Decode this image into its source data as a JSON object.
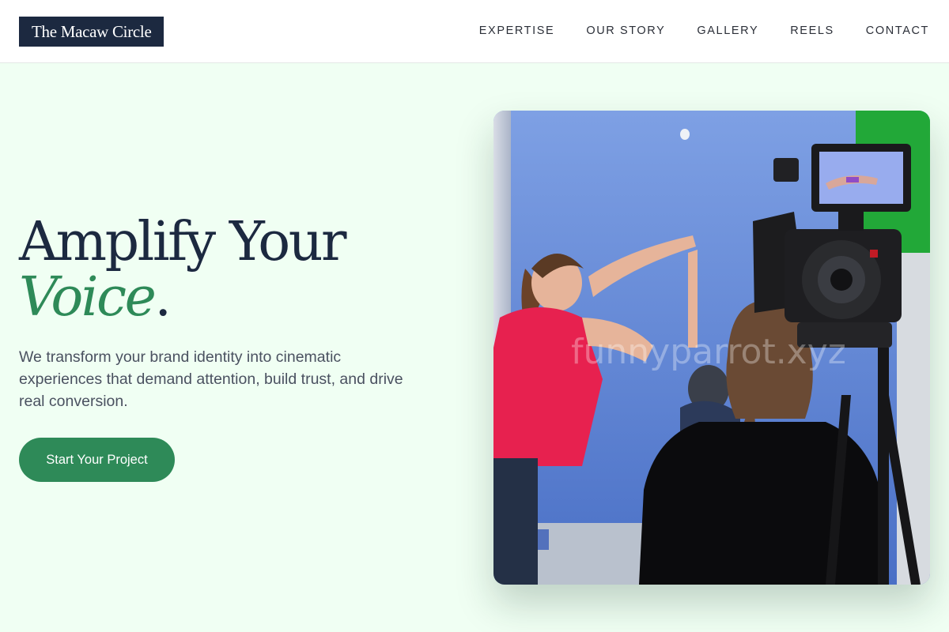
{
  "header": {
    "logo_text": "The Macaw Circle",
    "nav": [
      {
        "label": "EXPERTISE"
      },
      {
        "label": "OUR STORY"
      },
      {
        "label": "GALLERY"
      },
      {
        "label": "REELS"
      },
      {
        "label": "CONTACT"
      }
    ]
  },
  "hero": {
    "title_line1": "Amplify Your",
    "title_accent": "Voice",
    "title_period": ".",
    "description": "We transform your brand identity into cinematic experiences that demand attention, build trust, and drive real conversion.",
    "cta_label": "Start Your Project"
  },
  "photo": {
    "watermark": "funnyparrot.xyz"
  },
  "colors": {
    "brand_dark": "#1c2940",
    "accent_green": "#2e8a58",
    "page_background": "#f0fff3"
  }
}
